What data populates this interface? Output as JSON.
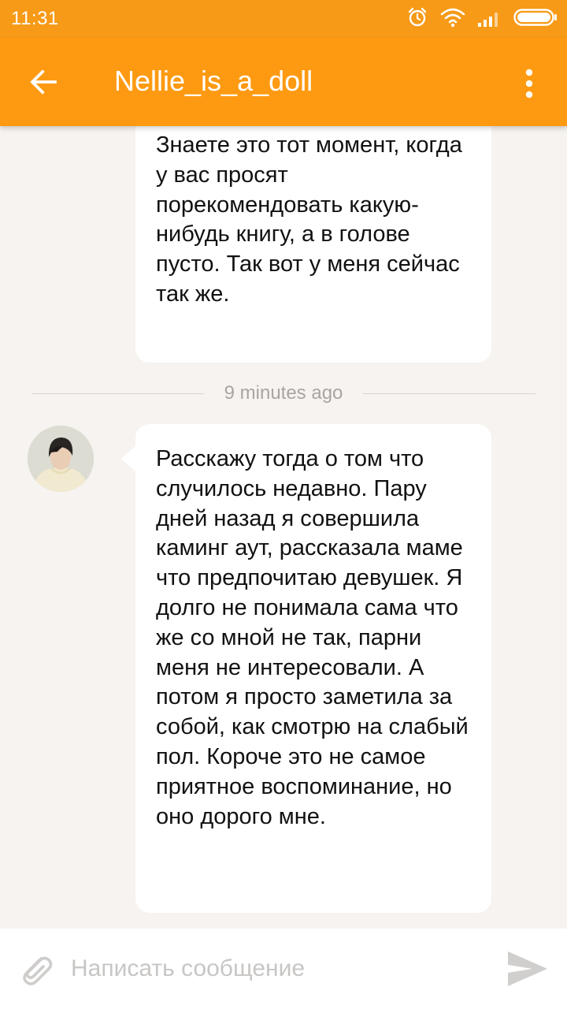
{
  "status_bar": {
    "time": "11:31",
    "icons": [
      "alarm-icon",
      "wifi-icon",
      "signal-icon",
      "battery-icon"
    ]
  },
  "header": {
    "title": "Nellie_is_a_doll",
    "back_icon": "arrow-left-icon",
    "menu_icon": "more-vertical-icon"
  },
  "messages": [
    {
      "text": "Знаете это тот момент, когда у вас просят порекомендовать какую-нибудь книгу, а в голове пусто. Так вот у меня сейчас так же."
    },
    {
      "text": "Расскажу тогда о том что случилось недавно. Пару дней назад я совершила каминг аут, рассказала маме что предпочитаю девушек. Я долго не понимала сама что же со мной не так, парни меня не интересовали. А потом я просто заметила за собой, как смотрю на слабый пол. Короче это не самое приятное воспоминание, но оно дорого мне."
    }
  ],
  "timestamp": "9 minutes ago",
  "composer": {
    "placeholder": "Написать сообщение",
    "attach_icon": "paperclip-icon",
    "send_icon": "send-icon"
  },
  "colors": {
    "app_bar": "#fd9a12",
    "status_bar": "#f79a17",
    "background": "#f6f3f0",
    "bubble": "#ffffff"
  }
}
